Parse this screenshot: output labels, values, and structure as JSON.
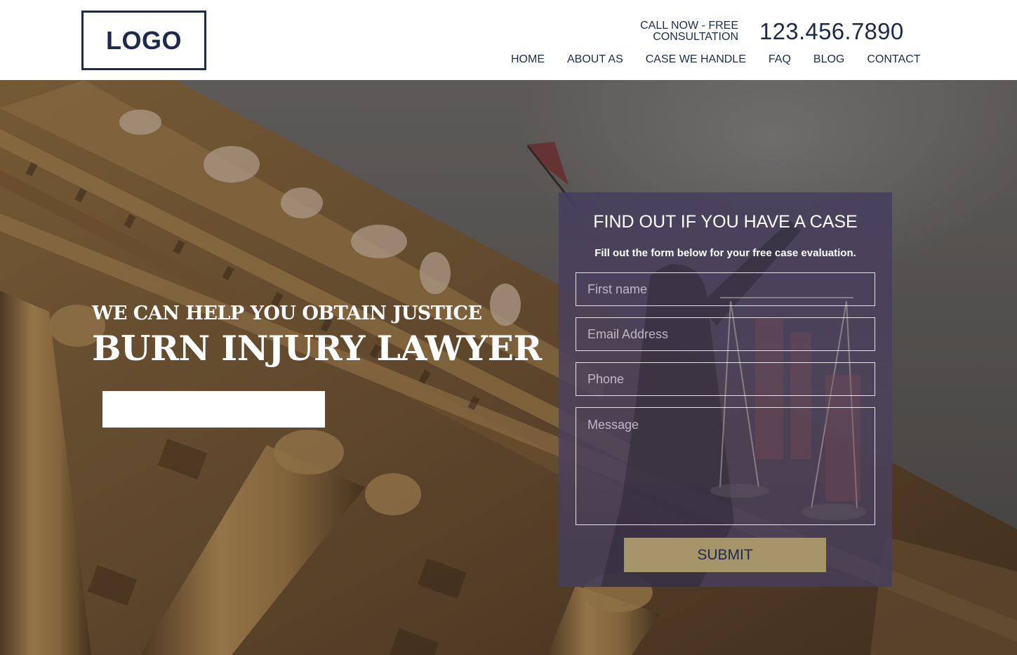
{
  "header": {
    "logo": "LOGO",
    "call_now": "CALL NOW - FREE CONSULTATION",
    "phone": "123.456.7890",
    "nav": [
      {
        "label": "HOME"
      },
      {
        "label": "ABOUT AS"
      },
      {
        "label": "CASE WE HANDLE"
      },
      {
        "label": "FAQ"
      },
      {
        "label": "BLOG"
      },
      {
        "label": "CONTACT"
      }
    ]
  },
  "hero": {
    "tagline": "WE CAN HELP YOU OBTAIN JUSTICE",
    "title": "BURN INJURY LAWYER",
    "cta_label": ""
  },
  "form": {
    "title": "FIND OUT IF YOU HAVE A CASE",
    "subtitle": "Fill out the form below for your free case evaluation.",
    "first_name_placeholder": "First name",
    "email_placeholder": "Email Address",
    "phone_placeholder": "Phone",
    "message_placeholder": "Message",
    "submit_label": "SUBMIT"
  },
  "colors": {
    "brand_navy": "#1b2a4e",
    "submit_gold": "#a6956b",
    "form_overlay": "#4a4060"
  }
}
